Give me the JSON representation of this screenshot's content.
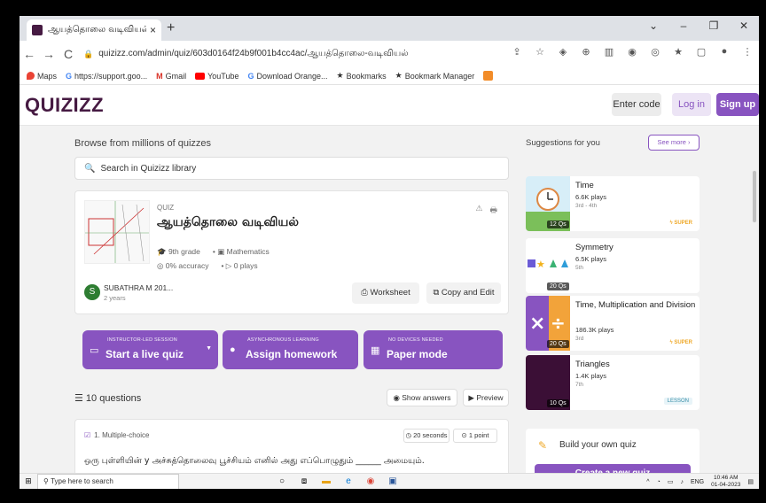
{
  "browser": {
    "tab_title": "ஆயத்தொலை வடிவியல் ப",
    "tab_close": "×",
    "new_tab": "+",
    "window_controls": [
      "⌄",
      "–",
      "❐",
      "✕"
    ],
    "nav": [
      "←",
      "→",
      "C"
    ],
    "url": "quizizz.com/admin/quiz/603d0164f24b9f001b4cc4ac/ஆயத்தொலை-வடிவியல்",
    "extensions": [
      "⇪",
      "☆",
      "◈",
      "⊕",
      "▥",
      "◉",
      "◎",
      "★",
      "▢",
      "●",
      "⋮"
    ]
  },
  "bookmarks": [
    {
      "label": "Maps",
      "icon": "maps-pin-icon",
      "color": "#ea4335"
    },
    {
      "label": "https://support.goo...",
      "icon": "google-icon",
      "color": "#4285f4"
    },
    {
      "label": "Gmail",
      "icon": "gmail-icon",
      "color": "#d93025"
    },
    {
      "label": "YouTube",
      "icon": "youtube-icon",
      "color": "#ff0000"
    },
    {
      "label": "Download Orange...",
      "icon": "google-icon",
      "color": "#4285f4"
    },
    {
      "label": "Bookmarks",
      "icon": "star-icon",
      "color": "#333333"
    },
    {
      "label": "Bookmark Manager",
      "icon": "star-icon",
      "color": "#333333"
    },
    {
      "label": "",
      "icon": "orange-app-icon",
      "color": "#f28c28"
    }
  ],
  "header": {
    "logo": "QUIZIZZ",
    "enter_code": "Enter code",
    "login": "Log in",
    "signup": "Sign up"
  },
  "main": {
    "browse_heading": "Browse from millions of quizzes",
    "search_placeholder": "Search in Quizizz library",
    "quiz": {
      "label": "QUIZ",
      "title": "ஆயத்தொலை வடிவியல்",
      "grade": "9th grade",
      "subject": "Mathematics",
      "accuracy": "0% accuracy",
      "plays": "0 plays",
      "author_initial": "S",
      "author": "SUBATHRA M 201...",
      "age": "2 years",
      "worksheet": "Worksheet",
      "copy_edit": "Copy and Edit"
    },
    "actions": [
      {
        "small": "INSTRUCTOR-LED SESSION",
        "label": "Start a live quiz"
      },
      {
        "small": "ASYNCHRONOUS LEARNING",
        "label": "Assign homework"
      },
      {
        "small": "NO DEVICES NEEDED",
        "label": "Paper mode"
      }
    ],
    "question_count": "10 questions",
    "show_answers": "Show answers",
    "preview": "Preview",
    "question": {
      "type": "1. Multiple-choice",
      "time": "20 seconds",
      "points": "1 point",
      "text": "ஒரு புள்ளியின் y அச்சுத்தொலைவு பூச்சியம் எனில் அது எப்பொழுதும் ______ அமையும்."
    }
  },
  "sidebar": {
    "title": "Suggestions for you",
    "see_more": "See more",
    "suggestions": [
      {
        "title": "Time",
        "plays": "6.6K plays",
        "grade": "3rd - 4th",
        "qs": "12 Qs",
        "badge": "SUPER"
      },
      {
        "title": "Symmetry",
        "plays": "6.5K plays",
        "grade": "5th",
        "qs": "20 Qs",
        "badge": ""
      },
      {
        "title": "Time, Multiplication and Division",
        "plays": "186.3K plays",
        "grade": "3rd",
        "qs": "20 Qs",
        "badge": "SUPER"
      },
      {
        "title": "Triangles",
        "plays": "1.4K plays",
        "grade": "7th",
        "qs": "10 Qs",
        "badge": "LESSON"
      }
    ],
    "build_title": "Build your own quiz",
    "create": "Create a new quiz"
  },
  "taskbar": {
    "search": "Type here to search",
    "lang": "ENG",
    "time": "10:46 AM",
    "date": "01-04-2023"
  },
  "colors": {
    "brand": "#461a42",
    "accent": "#8854c0",
    "super": "#efa929"
  }
}
